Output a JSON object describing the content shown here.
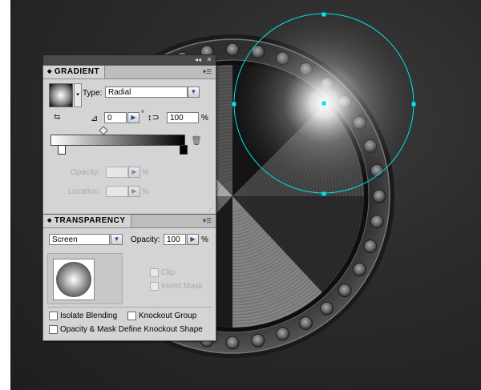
{
  "gradient_panel": {
    "title": "GRADIENT",
    "type_label": "Type:",
    "type_value": "Radial",
    "angle_value": "0",
    "degree_symbol": "°",
    "aspect_value": "100",
    "aspect_unit": "%",
    "opacity_label": "Opacity:",
    "opacity_unit": "%",
    "location_label": "Location:",
    "location_unit": "%"
  },
  "transparency_panel": {
    "title": "TRANSPARENCY",
    "blend_mode": "Screen",
    "opacity_label": "Opacity:",
    "opacity_value": "100",
    "opacity_unit": "%",
    "clip_label": "Clip",
    "invert_mask_label": "Invert Mask",
    "isolate_blending_label": "Isolate Blending",
    "knockout_group_label": "Knockout Group",
    "opacity_mask_label": "Opacity & Mask Define Knockout Shape"
  },
  "colors": {
    "selection": "#00e5e8",
    "panel_bg": "#d4d4d4",
    "canvas_bg": "#2a2a2a"
  }
}
